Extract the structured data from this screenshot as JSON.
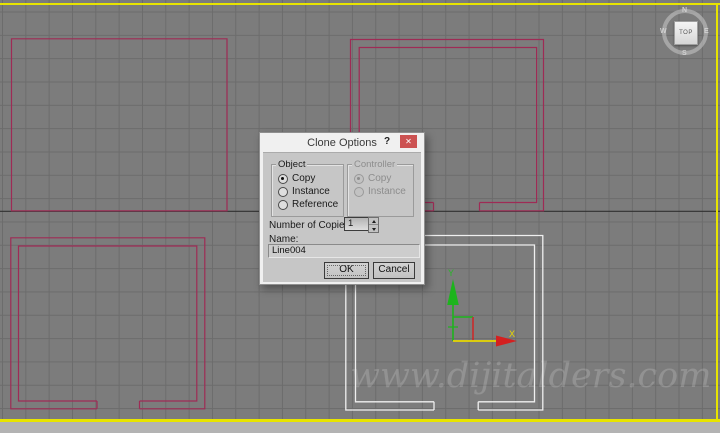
{
  "viewport": {
    "view_label": "TOP",
    "compass": {
      "n": "N",
      "s": "S",
      "e": "E",
      "w": "W"
    },
    "watermark": "www.dijitalders.com",
    "gizmo": {
      "x_label": "X",
      "y_label": "Y"
    }
  },
  "dialog": {
    "title": "Clone Options",
    "help_label": "?",
    "close_label": "✕",
    "object_group": {
      "label": "Object",
      "options": [
        {
          "label": "Copy",
          "selected": true
        },
        {
          "label": "Instance",
          "selected": false
        },
        {
          "label": "Reference",
          "selected": false
        }
      ]
    },
    "controller_group": {
      "label": "Controller",
      "disabled": true,
      "options": [
        {
          "label": "Copy",
          "selected": true
        },
        {
          "label": "Instance",
          "selected": false
        }
      ]
    },
    "copies": {
      "label": "Number of Copies:",
      "value": "1"
    },
    "name": {
      "label": "Name:",
      "value": "Line004"
    },
    "buttons": {
      "ok": "OK",
      "cancel": "Cancel"
    }
  },
  "colors": {
    "viewport_bg": "#7c7c7c",
    "grid_line": "#6c6c6c",
    "origin_axis": "#303030",
    "spline_red": "#9e2b55",
    "selected_spline_white": "#efefef",
    "active_viewport_border": "#e8e400",
    "gizmo_green": "#1db41d",
    "gizmo_red": "#d42020",
    "gizmo_yellow": "#e8d800",
    "close_button_red": "#cc5252"
  }
}
